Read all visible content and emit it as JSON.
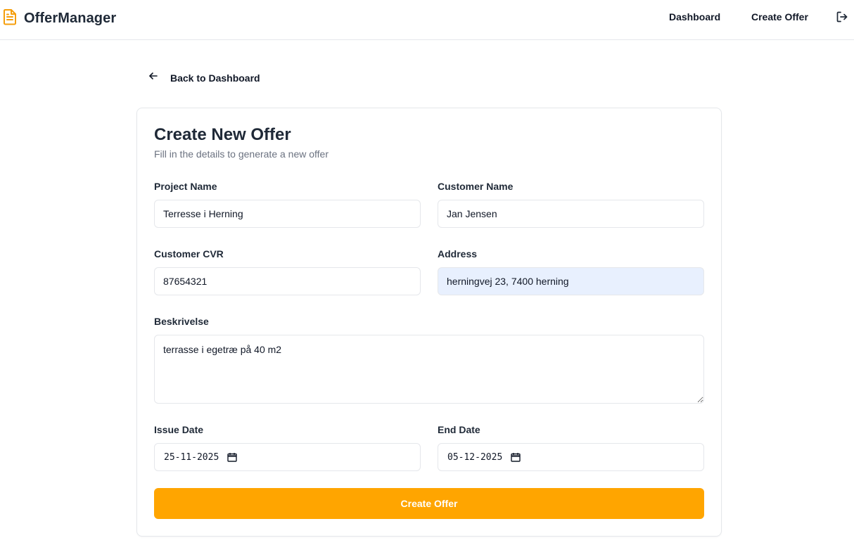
{
  "app": {
    "name": "OfferManager"
  },
  "nav": {
    "dashboard": "Dashboard",
    "create_offer": "Create Offer"
  },
  "back": {
    "label": "Back to Dashboard"
  },
  "form": {
    "title": "Create New Offer",
    "subtitle": "Fill in the details to generate a new offer",
    "project_name": {
      "label": "Project Name",
      "value": "Terresse i Herning"
    },
    "customer_name": {
      "label": "Customer Name",
      "value": "Jan Jensen"
    },
    "customer_cvr": {
      "label": "Customer CVR",
      "value": "87654321"
    },
    "address": {
      "label": "Address",
      "value": "herningvej 23, 7400 herning"
    },
    "description": {
      "label": "Beskrivelse",
      "value": "terrasse i egetræ på 40 m2"
    },
    "issue_date": {
      "label": "Issue Date",
      "value": "25-11-2025"
    },
    "end_date": {
      "label": "End Date",
      "value": "05-12-2025"
    },
    "submit_label": "Create Offer"
  },
  "colors": {
    "accent": "#ffa500",
    "autofill": "#e8f0fe"
  }
}
